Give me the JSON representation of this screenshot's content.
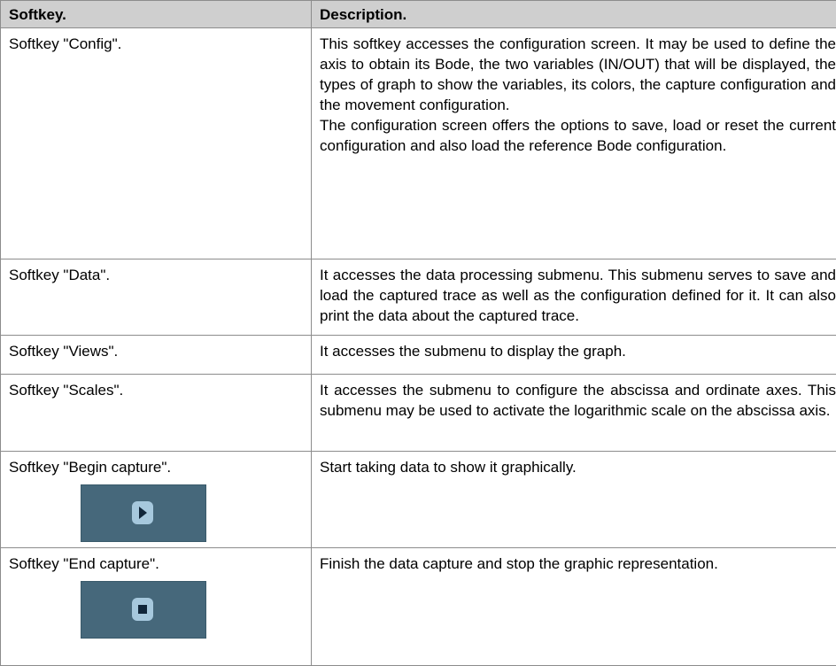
{
  "table": {
    "header": {
      "softkey": "Softkey.",
      "description": "Description."
    },
    "rows": [
      {
        "softkey": "Softkey \"Config\".",
        "description_p1": "This softkey accesses the configuration screen. It may be used to define the axis to obtain its Bode, the two variables (IN/OUT) that will be displayed, the types of graph to show the variables, its colors, the capture configuration and the movement configuration.",
        "description_p2": "The configuration screen offers the options to save, load or reset the current configuration and also load the reference Bode configuration."
      },
      {
        "softkey": "Softkey \"Data\".",
        "description": "It accesses the data processing submenu. This submenu serves to save and load the captured trace as well as the configuration defined for it. It can also print the data about the captured trace."
      },
      {
        "softkey": "Softkey \"Views\".",
        "description": "It accesses the submenu to display the graph."
      },
      {
        "softkey": "Softkey \"Scales\".",
        "description": "It accesses the submenu to configure the abscissa and ordinate axes. This submenu may be used to activate the logarithmic scale on the abscissa axis."
      },
      {
        "softkey": "Softkey \"Begin capture\".",
        "description": "Start taking data to show it graphically.",
        "icon": "play-icon"
      },
      {
        "softkey": "Softkey \"End capture\".",
        "description": "Finish the data capture and stop the graphic representation.",
        "icon": "stop-icon"
      }
    ]
  },
  "colors": {
    "header_bg": "#cfcfcf",
    "softkey_bg": "#46687b",
    "softkey_glyph_bg": "#a6c8dd",
    "softkey_glyph_fg": "#10263a",
    "border": "#8c8c8c"
  }
}
